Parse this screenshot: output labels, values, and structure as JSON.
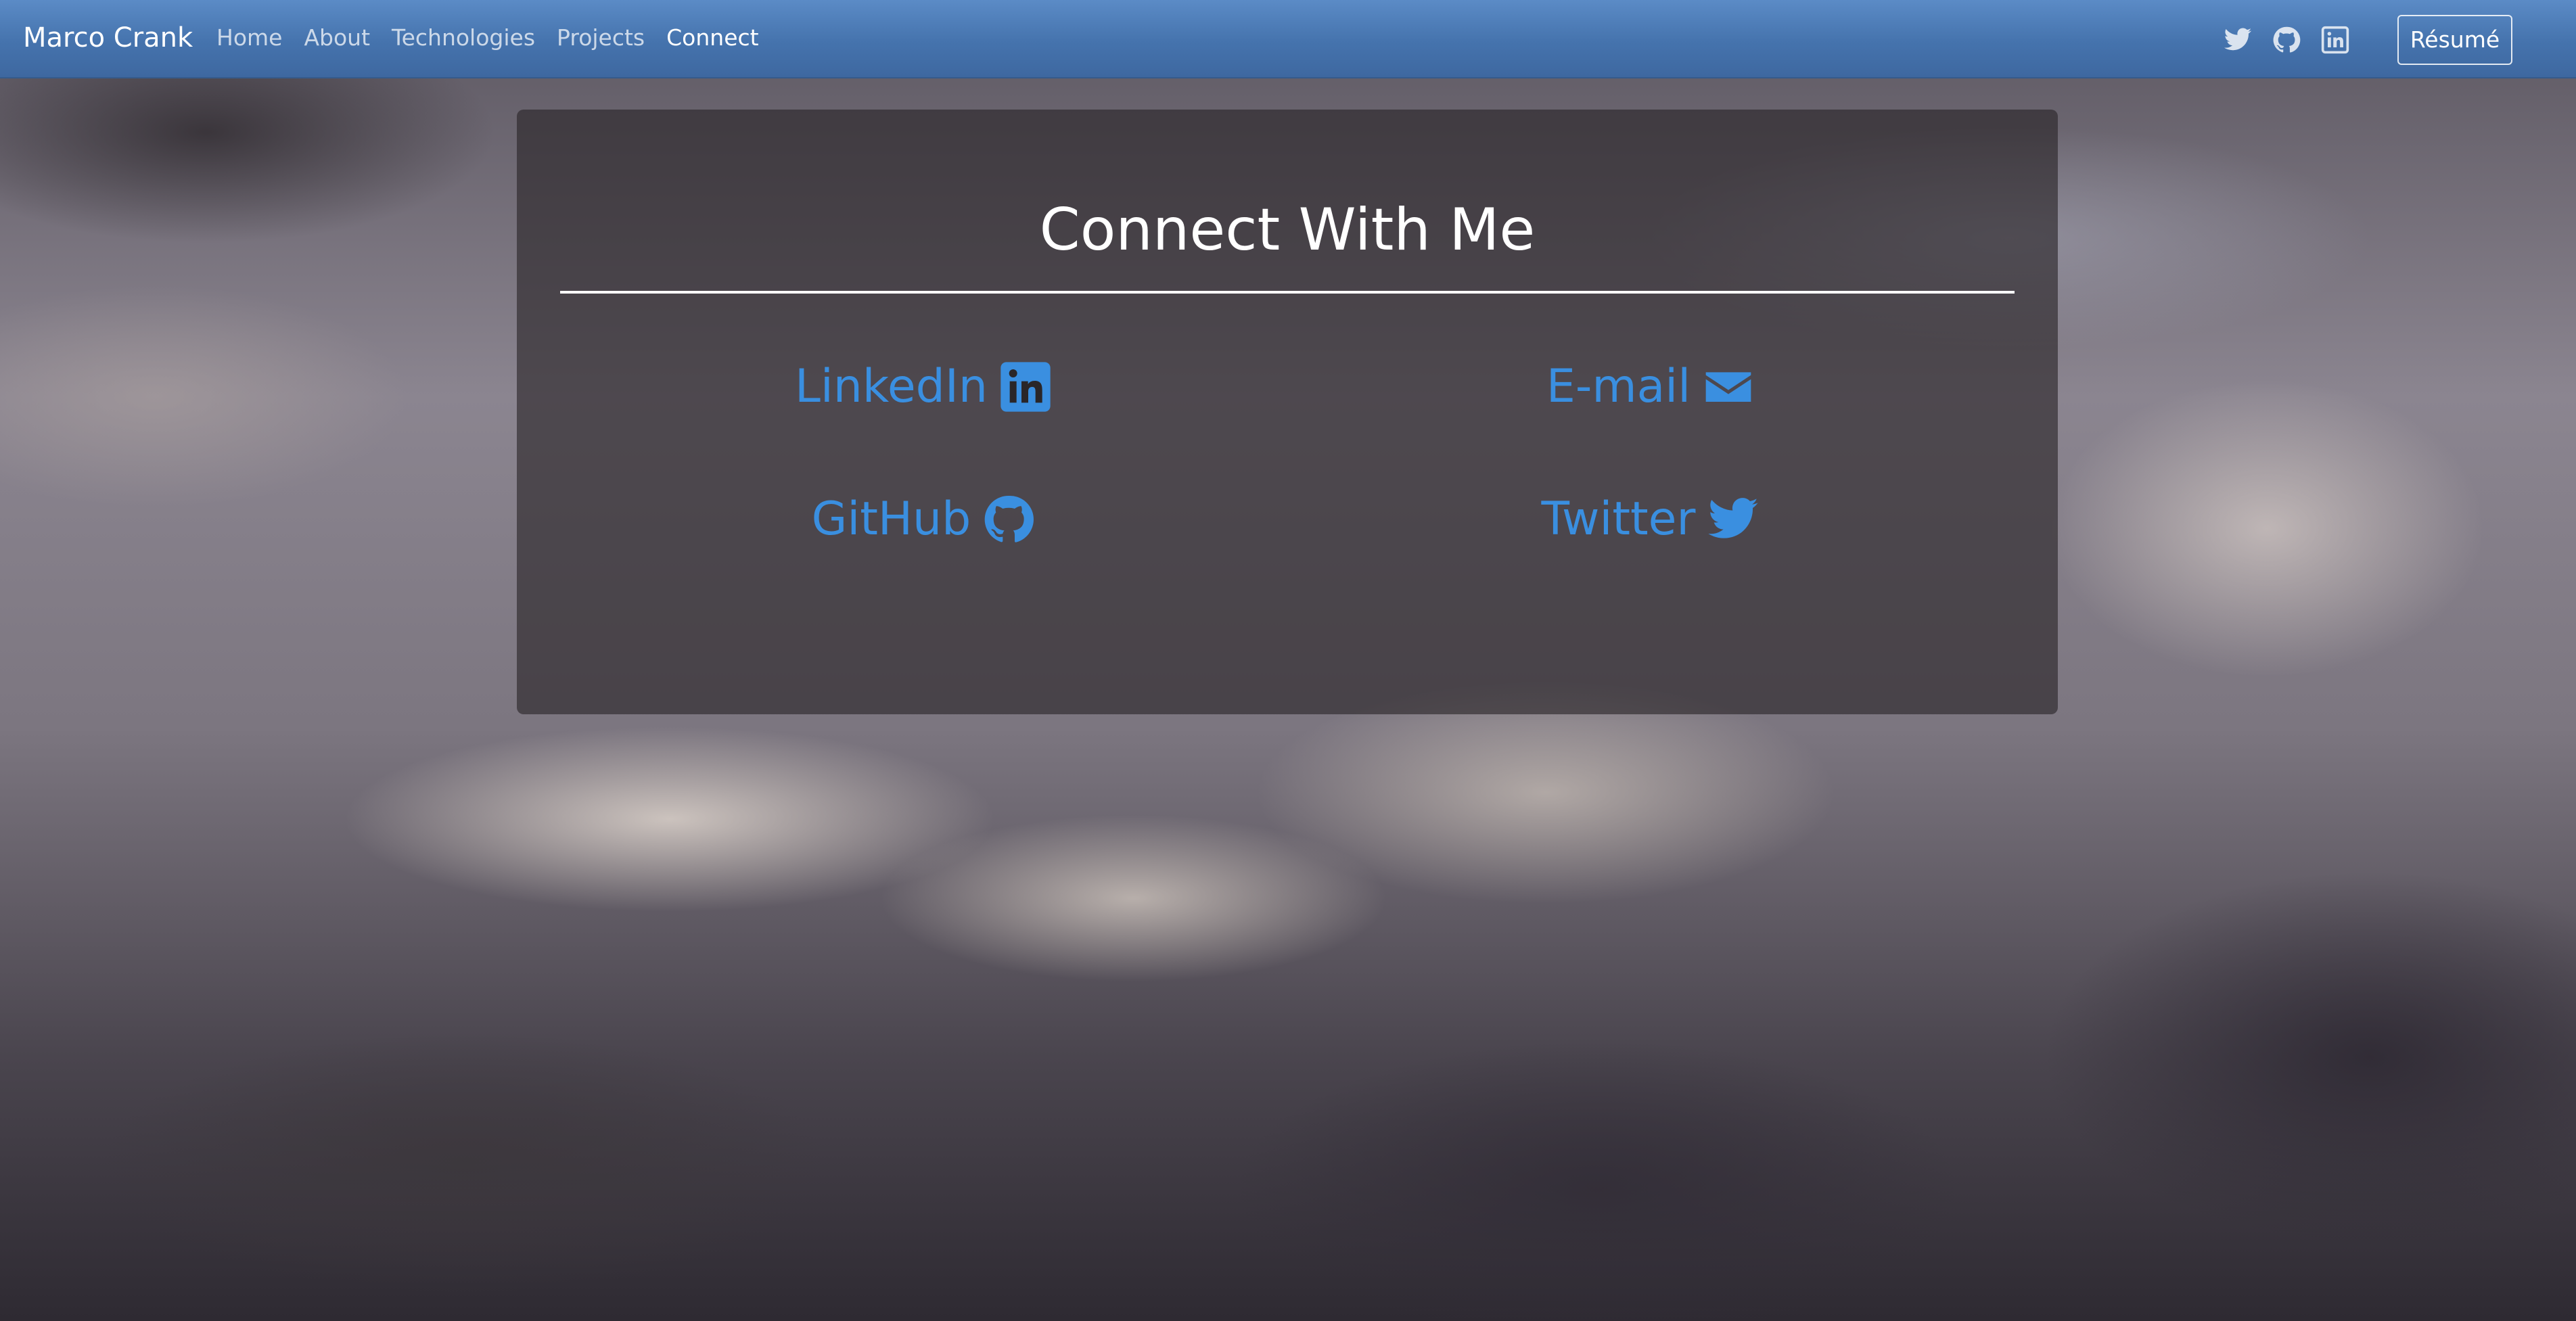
{
  "navbar": {
    "brand": "Marco Crank",
    "links": [
      {
        "label": "Home",
        "active": false
      },
      {
        "label": "About",
        "active": false
      },
      {
        "label": "Technologies",
        "active": false
      },
      {
        "label": "Projects",
        "active": false
      },
      {
        "label": "Connect",
        "active": true
      }
    ],
    "icons": [
      "twitter-icon",
      "github-icon",
      "linkedin-icon"
    ],
    "resume_label": "Résumé"
  },
  "connect": {
    "title": "Connect With Me",
    "links": [
      {
        "label": "LinkedIn",
        "icon": "linkedin-icon"
      },
      {
        "label": "E-mail",
        "icon": "envelope-icon"
      },
      {
        "label": "GitHub",
        "icon": "github-icon"
      },
      {
        "label": "Twitter",
        "icon": "twitter-icon"
      }
    ]
  },
  "colors": {
    "navbar": "#4573ad",
    "link": "#3a8fe0",
    "text": "#ffffff"
  }
}
